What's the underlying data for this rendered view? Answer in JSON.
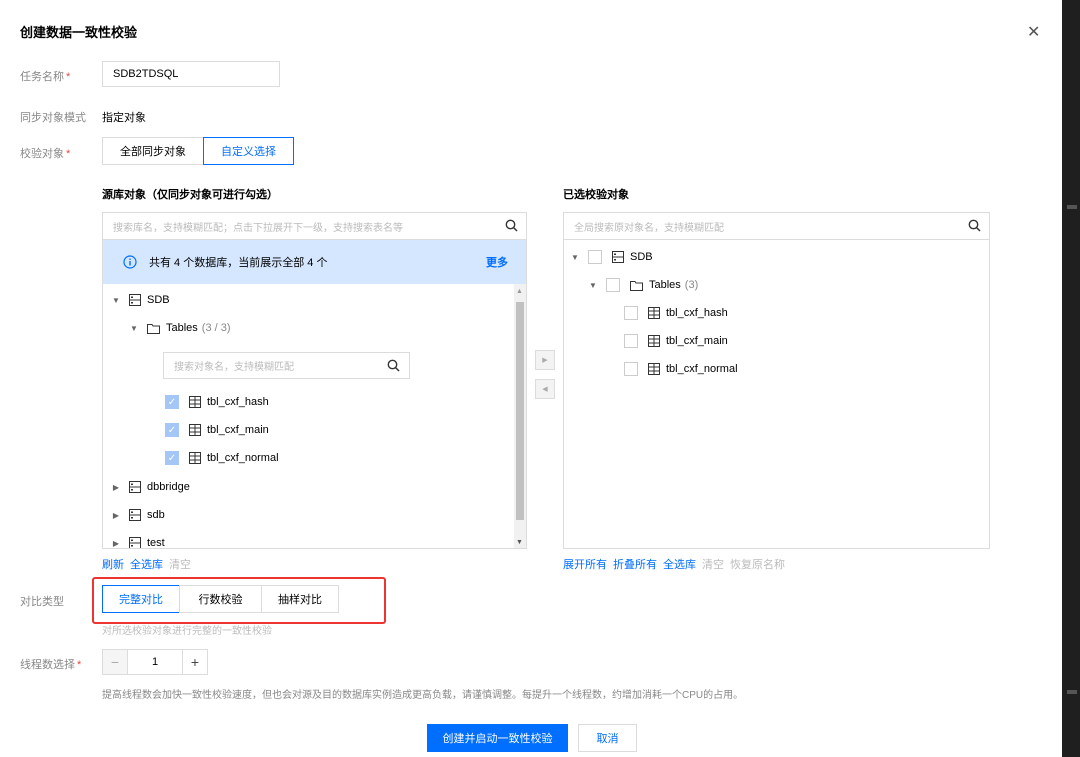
{
  "dialog": {
    "title": "创建数据一致性校验",
    "close_glyph": "✕"
  },
  "form": {
    "task_name_label": "任务名称",
    "task_name_value": "SDB2TDSQL",
    "sync_mode_label": "同步对象模式",
    "sync_mode_value": "指定对象",
    "check_object_label": "校验对象",
    "check_object_options": [
      "全部同步对象",
      "自定义选择"
    ],
    "check_object_selected": "自定义选择",
    "required_mark": "*"
  },
  "source": {
    "title": "源库对象（仅同步对象可进行勾选）",
    "search_placeholder": "搜索库名，支持模糊匹配；点击下拉展开下一级，支持搜索表名等",
    "info_text": "共有 4 个数据库，当前展示全部 4 个",
    "info_more": "更多",
    "tree": {
      "db_sdb": "SDB",
      "tables_label": "Tables",
      "tables_count": "(3 / 3)",
      "table_search_placeholder": "搜索对象名，支持模糊匹配",
      "tables": [
        "tbl_cxf_hash",
        "tbl_cxf_main",
        "tbl_cxf_normal"
      ],
      "other_dbs": [
        "dbbridge",
        "sdb",
        "test"
      ]
    },
    "actions": [
      "刷新",
      "全选库",
      "清空"
    ]
  },
  "target": {
    "title": "已选校验对象",
    "search_placeholder": "全局搜索原对象名，支持模糊匹配",
    "tree": {
      "db": "SDB",
      "tables_label": "Tables",
      "tables_count": "(3)",
      "tables": [
        "tbl_cxf_hash",
        "tbl_cxf_main",
        "tbl_cxf_normal"
      ]
    },
    "actions": [
      "展开所有",
      "折叠所有",
      "全选库",
      "清空",
      "恢复原名称"
    ]
  },
  "compare": {
    "label": "对比类型",
    "options": [
      "完整对比",
      "行数校验",
      "抽样对比"
    ],
    "selected": "完整对比",
    "hint": "对所选校验对象进行完整的一致性校验"
  },
  "threads": {
    "label": "线程数选择",
    "value": "1",
    "minus": "−",
    "plus": "+",
    "hint": "提高线程数会加快一致性校验速度，但也会对源及目的数据库实例造成更高负载，请谨慎调整。每提升一个线程数，约增加消耗一个CPU的占用。"
  },
  "footer": {
    "submit_label": "创建并启动一致性校验",
    "cancel_label": "取消"
  },
  "colors": {
    "primary": "#006eff",
    "info_bg": "#d5e7ff",
    "highlight_box": "#e33333"
  },
  "icons": {
    "search": "search-icon",
    "info": "info-icon",
    "database": "database-icon",
    "folder": "folder-icon",
    "table": "table-icon",
    "close": "close-icon"
  }
}
